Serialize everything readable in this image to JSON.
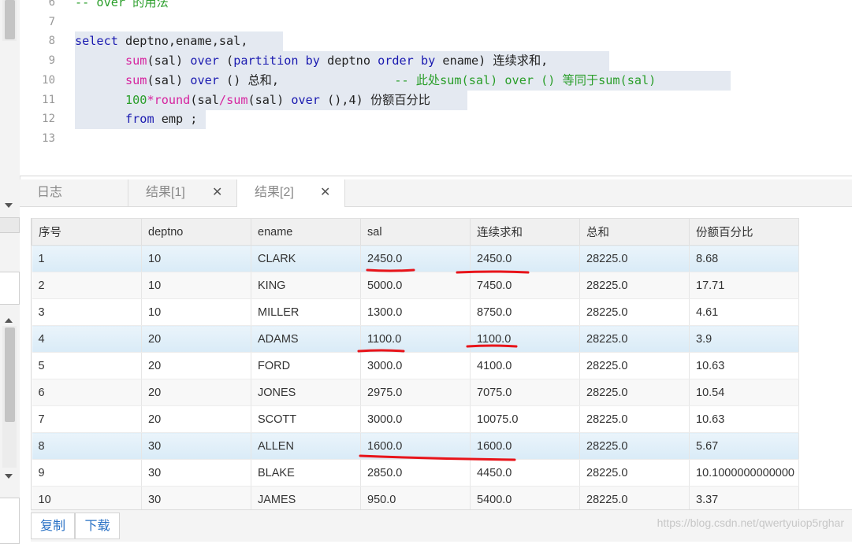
{
  "editor": {
    "lines": [
      {
        "n": "6",
        "tokens": [
          {
            "t": "-- over 的用法",
            "c": "#2a9e2a"
          }
        ]
      },
      {
        "n": "7",
        "tokens": []
      },
      {
        "n": "8",
        "tokens": [
          {
            "t": "select",
            "c": "#1a1ab0"
          },
          {
            "t": " deptno,ename,sal,",
            "c": "#222"
          }
        ]
      },
      {
        "n": "9",
        "tokens": [
          {
            "t": "       ",
            "c": "indent"
          },
          {
            "t": "sum",
            "c": "#d6249f"
          },
          {
            "t": "(sal) ",
            "c": "#222"
          },
          {
            "t": "over",
            "c": "#1a1ab0"
          },
          {
            "t": " (",
            "c": "#222"
          },
          {
            "t": "partition",
            "c": "#1a1ab0"
          },
          {
            "t": " ",
            "c": "#222"
          },
          {
            "t": "by",
            "c": "#1a1ab0"
          },
          {
            "t": " deptno ",
            "c": "#222"
          },
          {
            "t": "order",
            "c": "#1a1ab0"
          },
          {
            "t": " ",
            "c": "#222"
          },
          {
            "t": "by",
            "c": "#1a1ab0"
          },
          {
            "t": " ename) 连续求和,",
            "c": "#222"
          }
        ]
      },
      {
        "n": "10",
        "tokens": [
          {
            "t": "       ",
            "c": "indent"
          },
          {
            "t": "sum",
            "c": "#d6249f"
          },
          {
            "t": "(sal) ",
            "c": "#222"
          },
          {
            "t": "over",
            "c": "#1a1ab0"
          },
          {
            "t": " () 总和,                ",
            "c": "#222"
          },
          {
            "t": "-- 此处sum(sal) over () 等同于sum(sal)",
            "c": "#2a9e2a"
          }
        ]
      },
      {
        "n": "11",
        "tokens": [
          {
            "t": "       ",
            "c": "indent"
          },
          {
            "t": "100",
            "c": "#2a9e2a"
          },
          {
            "t": "*",
            "c": "#d6249f"
          },
          {
            "t": "round",
            "c": "#d6249f"
          },
          {
            "t": "(sal",
            "c": "#222"
          },
          {
            "t": "/",
            "c": "#d6249f"
          },
          {
            "t": "sum",
            "c": "#d6249f"
          },
          {
            "t": "(sal) ",
            "c": "#222"
          },
          {
            "t": "over",
            "c": "#1a1ab0"
          },
          {
            "t": " (),4) 份额百分比",
            "c": "#222"
          }
        ]
      },
      {
        "n": "12",
        "tokens": [
          {
            "t": "       ",
            "c": "indent"
          },
          {
            "t": "from",
            "c": "#1a1ab0"
          },
          {
            "t": " emp ;",
            "c": "#222"
          }
        ]
      },
      {
        "n": "13",
        "tokens": []
      }
    ]
  },
  "tabs": [
    {
      "label": "日志",
      "closable": false,
      "active": false
    },
    {
      "label": "结果[1]",
      "closable": true,
      "active": false
    },
    {
      "label": "结果[2]",
      "closable": true,
      "active": true
    }
  ],
  "close_glyph": "✕",
  "grid": {
    "columns": [
      "序号",
      "deptno",
      "ename",
      "sal",
      "连续求和",
      "总和",
      "份额百分比"
    ],
    "rows": [
      [
        "1",
        "10",
        "CLARK",
        "2450.0",
        "2450.0",
        "28225.0",
        "8.68"
      ],
      [
        "2",
        "10",
        "KING",
        "5000.0",
        "7450.0",
        "28225.0",
        "17.71"
      ],
      [
        "3",
        "10",
        "MILLER",
        "1300.0",
        "8750.0",
        "28225.0",
        "4.61"
      ],
      [
        "4",
        "20",
        "ADAMS",
        "1100.0",
        "1100.0",
        "28225.0",
        "3.9"
      ],
      [
        "5",
        "20",
        "FORD",
        "3000.0",
        "4100.0",
        "28225.0",
        "10.63"
      ],
      [
        "6",
        "20",
        "JONES",
        "2975.0",
        "7075.0",
        "28225.0",
        "10.54"
      ],
      [
        "7",
        "20",
        "SCOTT",
        "3000.0",
        "10075.0",
        "28225.0",
        "10.63"
      ],
      [
        "8",
        "30",
        "ALLEN",
        "1600.0",
        "1600.0",
        "28225.0",
        "5.67"
      ],
      [
        "9",
        "30",
        "BLAKE",
        "2850.0",
        "4450.0",
        "28225.0",
        "10.1000000000000"
      ],
      [
        "10",
        "30",
        "JAMES",
        "950.0",
        "5400.0",
        "28225.0",
        "3.37"
      ]
    ],
    "highlighted_rows": [
      0,
      3,
      7
    ]
  },
  "toolbar": {
    "copy_label": "复制",
    "download_label": "下载"
  },
  "watermark": "https://blog.csdn.net/qwertyuiop5rghar",
  "annotation_color": "#e8141a"
}
